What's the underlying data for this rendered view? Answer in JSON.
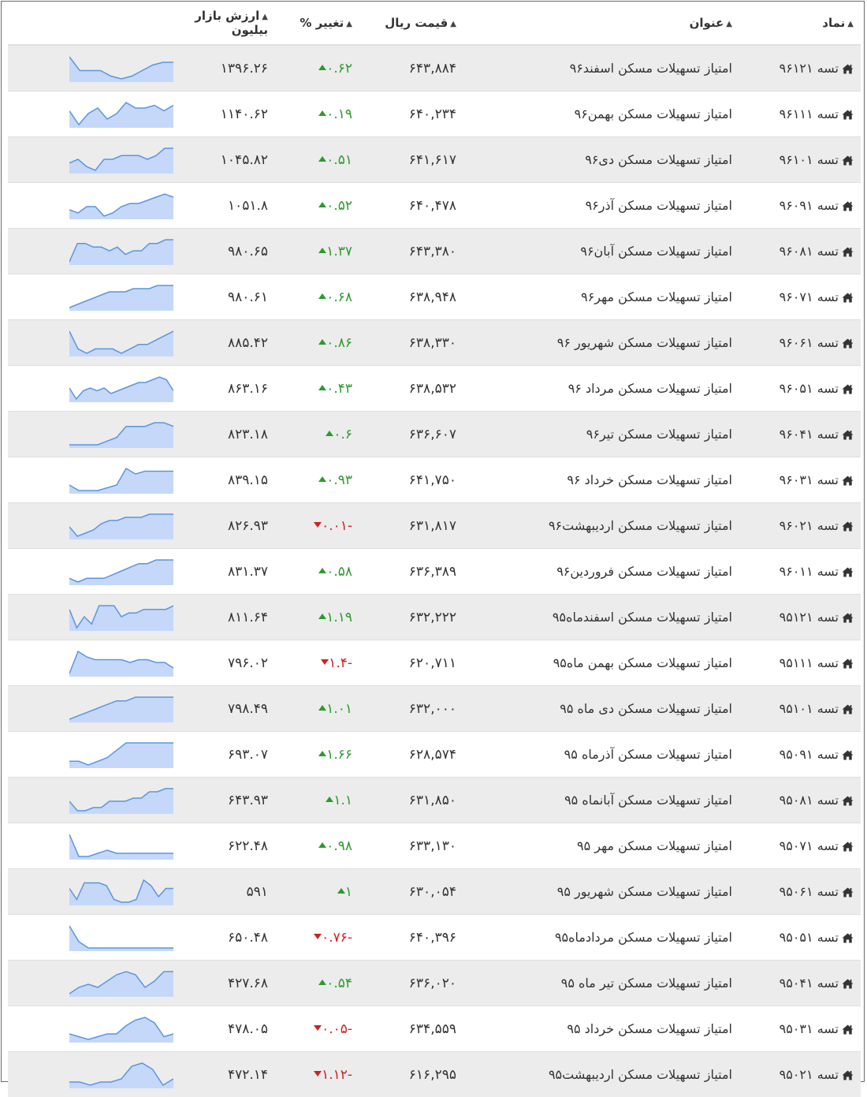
{
  "headers": {
    "symbol": "نماد",
    "title": "عنوان",
    "price": "قیمت ریال",
    "change": "تغییر %",
    "market_cap": "ارزش بازار بیلیون"
  },
  "colors": {
    "up": "#2c9b2c",
    "down": "#cc2222",
    "spark_line": "#5b95e0",
    "spark_fill": "#c5d8fa"
  },
  "rows": [
    {
      "symbol": "تسه ۹۶۱۲۱",
      "title": "امتیاز تسهیلات مسکن اسفند۹۶",
      "price": "۶۴۳,۸۸۴",
      "change": "۰.۶۲",
      "direction": "up",
      "market_cap": "۱۳۹۶.۲۶",
      "spark": [
        8,
        3,
        3,
        3,
        1,
        0,
        1,
        3,
        5,
        6,
        6
      ]
    },
    {
      "symbol": "تسه ۹۶۱۱۱",
      "title": "امتیاز تسهیلات مسکن بهمن۹۶",
      "price": "۶۴۰,۲۳۴",
      "change": "۰.۱۹",
      "direction": "up",
      "market_cap": "۱۱۴۰.۶۲",
      "spark": [
        5,
        0,
        4,
        6,
        2,
        4,
        8,
        6,
        6,
        7,
        5,
        7
      ]
    },
    {
      "symbol": "تسه ۹۶۱۰۱",
      "title": "امتیاز تسهیلات مسکن دی۹۶",
      "price": "۶۴۱,۶۱۷",
      "change": "۰.۵۱",
      "direction": "up",
      "market_cap": "۱۰۴۵.۸۲",
      "spark": [
        3,
        4,
        2,
        1,
        4,
        4,
        5,
        5,
        5,
        4,
        5,
        7,
        7
      ]
    },
    {
      "symbol": "تسه ۹۶۰۹۱",
      "title": "امتیاز تسهیلات مسکن آذر۹۶",
      "price": "۶۴۰,۴۷۸",
      "change": "۰.۵۲",
      "direction": "up",
      "market_cap": "۱۰۵۱.۸",
      "spark": [
        3,
        2,
        4,
        4,
        1,
        2,
        4,
        5,
        5,
        6,
        7,
        8,
        7
      ]
    },
    {
      "symbol": "تسه ۹۶۰۸۱",
      "title": "امتیاز تسهیلات مسکن آبان۹۶",
      "price": "۶۴۳,۳۸۰",
      "change": "۱.۳۷",
      "direction": "up",
      "market_cap": "۹۸۰.۶۵",
      "spark": [
        1,
        6,
        6,
        5,
        5,
        4,
        5,
        3,
        4,
        4,
        6,
        6,
        7,
        7
      ]
    },
    {
      "symbol": "تسه ۹۶۰۷۱",
      "title": "امتیاز تسهیلات مسکن مهر۹۶",
      "price": "۶۳۸,۹۴۸",
      "change": "۰.۶۸",
      "direction": "up",
      "market_cap": "۹۸۰.۶۱",
      "spark": [
        1,
        2,
        3,
        4,
        5,
        6,
        6,
        6,
        7,
        7,
        7,
        8,
        8,
        8
      ]
    },
    {
      "symbol": "تسه ۹۶۰۶۱",
      "title": "امتیاز تسهیلات مسکن شهریور ۹۶",
      "price": "۶۳۸,۳۳۰",
      "change": "۰.۸۶",
      "direction": "up",
      "market_cap": "۸۸۵.۴۲",
      "spark": [
        7,
        3,
        2,
        3,
        3,
        3,
        2,
        3,
        4,
        4,
        5,
        6,
        7
      ]
    },
    {
      "symbol": "تسه ۹۶۰۵۱",
      "title": "امتیاز تسهیلات مسکن مرداد ۹۶",
      "price": "۶۳۸,۵۳۲",
      "change": "۰.۴۳",
      "direction": "up",
      "market_cap": "۸۶۳.۱۶",
      "spark": [
        4,
        0,
        3,
        4,
        3,
        4,
        2,
        3,
        4,
        5,
        6,
        6,
        7,
        8,
        7,
        3
      ]
    },
    {
      "symbol": "تسه ۹۶۰۴۱",
      "title": "امتیاز تسهیلات مسکن تیر۹۶",
      "price": "۶۳۶,۶۰۷",
      "change": "۰.۶",
      "direction": "up",
      "market_cap": "۸۲۳.۱۸",
      "spark": [
        1,
        1,
        1,
        1,
        2,
        3,
        6,
        6,
        6,
        7,
        7,
        6
      ]
    },
    {
      "symbol": "تسه ۹۶۰۳۱",
      "title": "امتیاز تسهیلات مسکن خرداد ۹۶",
      "price": "۶۴۱,۷۵۰",
      "change": "۰.۹۳",
      "direction": "up",
      "market_cap": "۸۳۹.۱۵",
      "spark": [
        2,
        0,
        0,
        0,
        1,
        2,
        8,
        6,
        7,
        7,
        7,
        7
      ]
    },
    {
      "symbol": "تسه ۹۶۰۲۱",
      "title": "امتیاز تسهیلات مسکن اردیبهشت۹۶",
      "price": "۶۳۱,۸۱۷",
      "change": "-۰.۰۱",
      "direction": "down",
      "market_cap": "۸۲۶.۹۳",
      "spark": [
        3,
        0,
        1,
        2,
        4,
        5,
        5,
        6,
        6,
        6,
        7,
        7,
        7,
        7
      ]
    },
    {
      "symbol": "تسه ۹۶۰۱۱",
      "title": "امتیاز تسهیلات مسکن فروردین۹۶",
      "price": "۶۳۶,۳۸۹",
      "change": "۰.۵۸",
      "direction": "up",
      "market_cap": "۸۳۱.۳۷",
      "spark": [
        2,
        1,
        2,
        2,
        2,
        3,
        4,
        5,
        6,
        6,
        7,
        7,
        7
      ]
    },
    {
      "symbol": "تسه ۹۵۱۲۱",
      "title": "امتیاز تسهیلات مسکن اسفندماه۹۵",
      "price": "۶۳۲,۲۲۲",
      "change": "۱.۱۹",
      "direction": "up",
      "market_cap": "۸۱۱.۶۴",
      "spark": [
        5,
        0,
        3,
        1,
        6,
        6,
        6,
        3,
        4,
        4,
        5,
        5,
        5,
        5,
        6
      ]
    },
    {
      "symbol": "تسه ۹۵۱۱۱",
      "title": "امتیاز تسهیلات مسکن بهمن ماه۹۵",
      "price": "۶۲۰,۷۱۱",
      "change": "-۱.۴",
      "direction": "down",
      "market_cap": "۷۹۶.۰۲",
      "spark": [
        0,
        8,
        6,
        5,
        5,
        5,
        5,
        4,
        5,
        5,
        4,
        4,
        2
      ]
    },
    {
      "symbol": "تسه ۹۵۱۰۱",
      "title": "امتیاز تسهیلات مسکن دی ماه ۹۵",
      "price": "۶۳۲,۰۰۰",
      "change": "۱.۰۱",
      "direction": "up",
      "market_cap": "۷۹۸.۴۹",
      "spark": [
        1,
        2,
        3,
        4,
        5,
        6,
        6,
        7,
        7,
        7,
        7,
        7
      ]
    },
    {
      "symbol": "تسه ۹۵۰۹۱",
      "title": "امتیاز تسهیلات مسکن آذرماه ۹۵",
      "price": "۶۲۸,۵۷۴",
      "change": "۱.۶۶",
      "direction": "up",
      "market_cap": "۶۹۳.۰۷",
      "spark": [
        1,
        1,
        0,
        1,
        2,
        4,
        6,
        6,
        6,
        6,
        6,
        6
      ]
    },
    {
      "symbol": "تسه ۹۵۰۸۱",
      "title": "امتیاز تسهیلات مسکن آبانماه ۹۵",
      "price": "۶۳۱,۸۵۰",
      "change": "۱.۱",
      "direction": "up",
      "market_cap": "۶۴۳.۹۳",
      "spark": [
        3,
        0,
        0,
        1,
        1,
        3,
        3,
        3,
        4,
        4,
        6,
        6,
        7,
        7
      ]
    },
    {
      "symbol": "تسه ۹۵۰۷۱",
      "title": "امتیاز تسهیلات مسکن مهر ۹۵",
      "price": "۶۳۳,۱۳۰",
      "change": "۰.۹۸",
      "direction": "up",
      "market_cap": "۶۲۲.۴۸",
      "spark": [
        8,
        1,
        1,
        2,
        3,
        2,
        2,
        2,
        2,
        2,
        2,
        2
      ]
    },
    {
      "symbol": "تسه ۹۵۰۶۱",
      "title": "امتیاز تسهیلات مسکن شهریور ۹۵",
      "price": "۶۳۰,۰۵۴",
      "change": "۱",
      "direction": "up",
      "market_cap": "۵۹۱",
      "spark": [
        5,
        1,
        7,
        7,
        7,
        6,
        1,
        0,
        0,
        1,
        8,
        6,
        2,
        5,
        5
      ]
    },
    {
      "symbol": "تسه ۹۵۰۵۱",
      "title": "امتیاز تسهیلات مسکن مردادماه۹۵",
      "price": "۶۴۰,۳۹۶",
      "change": "-۰.۷۶",
      "direction": "down",
      "market_cap": "۶۵۰.۴۸",
      "spark": [
        8,
        3,
        1,
        1,
        1,
        1,
        1,
        1,
        1,
        1,
        1,
        1
      ]
    },
    {
      "symbol": "تسه ۹۵۰۴۱",
      "title": "امتیاز تسهیلات مسکن تیر ماه ۹۵",
      "price": "۶۳۶,۰۲۰",
      "change": "۰.۵۴",
      "direction": "up",
      "market_cap": "۴۲۷.۶۸",
      "spark": [
        0,
        2,
        3,
        2,
        4,
        6,
        7,
        6,
        2,
        4,
        7,
        7
      ]
    },
    {
      "symbol": "تسه ۹۵۰۳۱",
      "title": "امتیاز تسهیلات مسکن خرداد ۹۵",
      "price": "۶۳۴,۵۵۹",
      "change": "-۰.۰۵",
      "direction": "down",
      "market_cap": "۴۷۸.۰۵",
      "spark": [
        2,
        1,
        0,
        1,
        2,
        2,
        5,
        7,
        8,
        6,
        1,
        2
      ]
    },
    {
      "symbol": "تسه ۹۵۰۲۱",
      "title": "امتیاز تسهیلات مسکن اردیبهشت۹۵",
      "price": "۶۱۶,۲۹۵",
      "change": "-۱.۱۲",
      "direction": "down",
      "market_cap": "۴۷۲.۱۴",
      "spark": [
        1,
        1,
        0,
        1,
        1,
        2,
        6,
        7,
        5,
        0,
        2
      ]
    }
  ]
}
